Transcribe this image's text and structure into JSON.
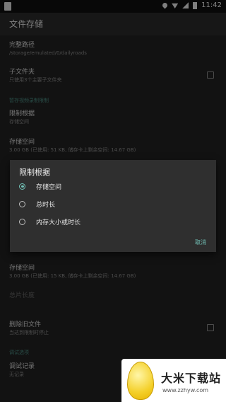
{
  "status_bar": {
    "time": "11:42"
  },
  "app_bar": {
    "title": "文件存储"
  },
  "prefs": {
    "full_path": {
      "title": "完整路径",
      "summary": "/storage/emulated/0/dailyroads"
    },
    "subfolder": {
      "title": "子文件夹",
      "summary": "只使用3个主要子文件夹"
    },
    "section_limit": "暂存视频录制限制",
    "limit_basis": {
      "title": "限制根据",
      "summary": "存储空间"
    },
    "storage_space": {
      "title": "存储空间",
      "summary": "3.00 GB (已使用: 51 KB, 储存卡上剩余空间: 14.67 GB)"
    },
    "storage_space2": {
      "title": "存储空间",
      "summary": "3.00 GB (已使用: 15 KB, 储存卡上剩余空间: 14.67 GB)"
    },
    "duration_dim": {
      "title": "总片长度",
      "summary": ""
    },
    "delete_old": {
      "title": "删除旧文件",
      "summary": "当达到限制时停止"
    },
    "section_debug": "调试选项",
    "debug_log": {
      "title": "调试记录",
      "summary": "无记录"
    }
  },
  "dialog": {
    "title": "限制根据",
    "options": [
      "存储空间",
      "总时长",
      "内存大小或时长"
    ],
    "selected_index": 0,
    "cancel": "取消"
  },
  "watermark": {
    "text": "大米下载站",
    "url": "www.zzhyw.com"
  },
  "colors": {
    "accent": "#72c1b7",
    "section": "#4a8a80"
  }
}
